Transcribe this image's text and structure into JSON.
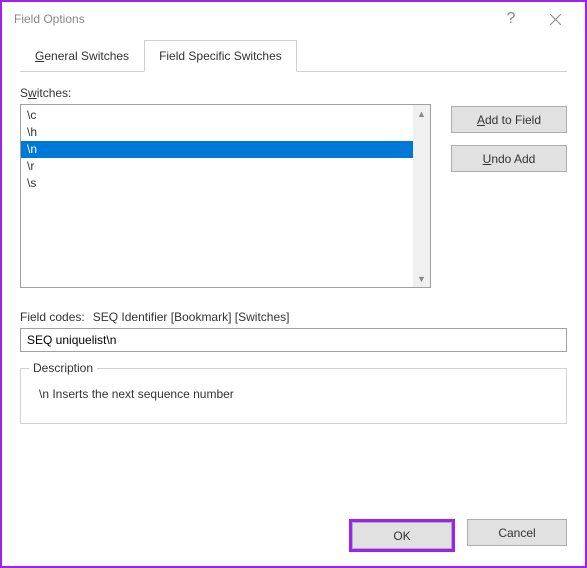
{
  "titlebar": {
    "title": "Field Options"
  },
  "tabs": {
    "general": "General Switches",
    "specific": "Field Specific Switches"
  },
  "switches": {
    "label": "Switches:",
    "items": [
      "\\c",
      "\\h",
      "\\n",
      "\\r",
      "\\s"
    ],
    "selected_index": 2
  },
  "buttons": {
    "add": "Add to Field",
    "undo": "Undo Add",
    "ok": "OK",
    "cancel": "Cancel"
  },
  "fieldcodes": {
    "label": "Field codes:",
    "format": "SEQ Identifier [Bookmark] [Switches]",
    "value": "SEQ uniquelist\\n"
  },
  "description": {
    "legend": "Description",
    "text": "\\n Inserts the next sequence number"
  }
}
